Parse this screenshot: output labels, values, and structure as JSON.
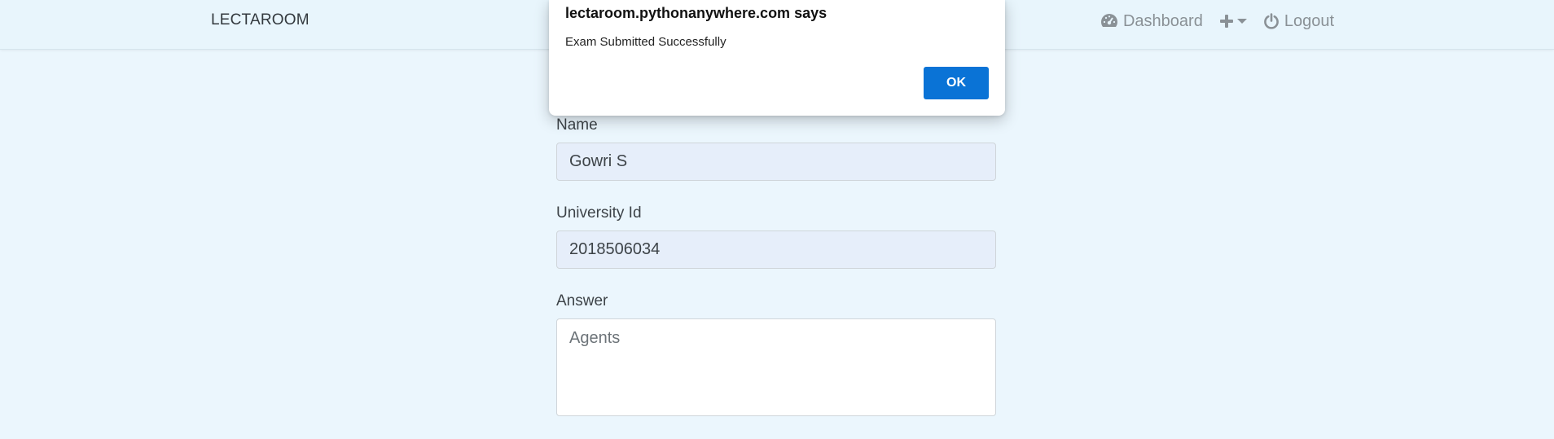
{
  "navbar": {
    "brand": "LECTAROOM",
    "dashboard_label": "Dashboard",
    "logout_label": "Logout"
  },
  "form": {
    "name_label": "Name",
    "name_value": "Gowri S",
    "university_id_label": "University Id",
    "university_id_value": "2018506034",
    "answer_label": "Answer",
    "answer_value": "Agents"
  },
  "dialog": {
    "title": "lectaroom.pythonanywhere.com says",
    "message": "Exam Submitted Successfully",
    "ok_label": "OK"
  },
  "icons": {
    "dashboard": "tachometer-icon",
    "add": "plus-icon",
    "caret": "caret-down-icon",
    "logout": "power-icon"
  },
  "colors": {
    "background": "#ebf6fd",
    "ok_button": "#0a73d6",
    "nav_text": "#8a9196"
  }
}
